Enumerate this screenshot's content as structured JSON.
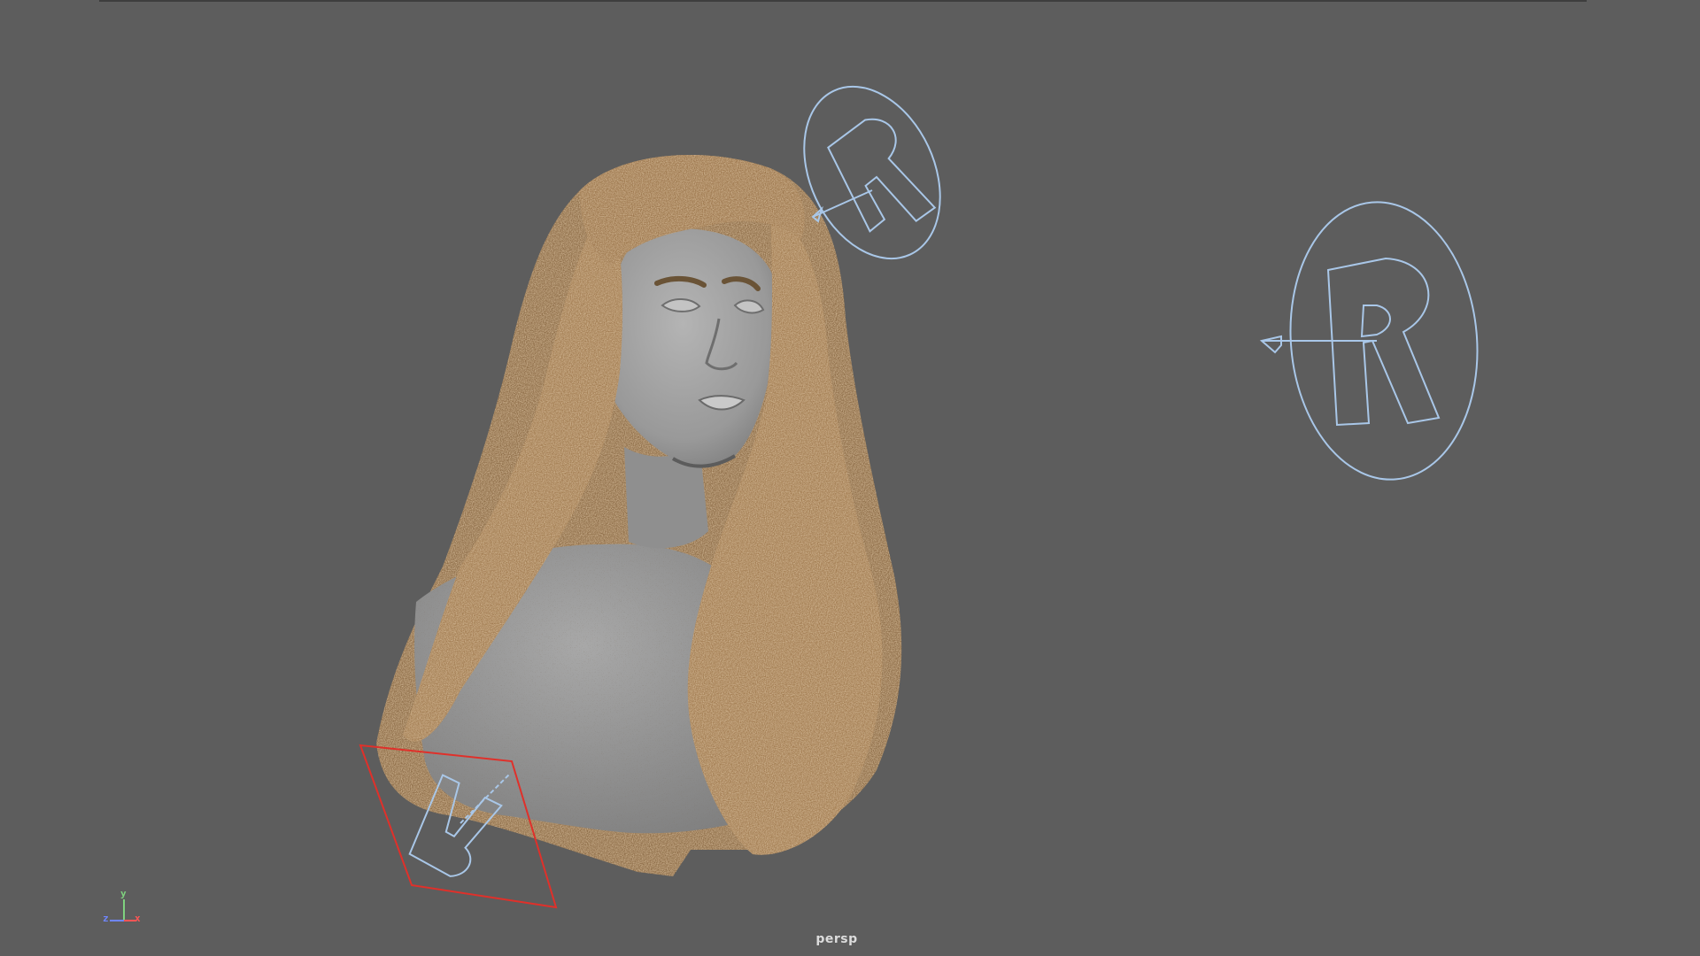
{
  "viewport": {
    "camera_name": "persp",
    "background_color": "#5d5d5d"
  },
  "axis_gizmo": {
    "x_label": "x",
    "y_label": "y",
    "z_label": "z",
    "x_color": "#ff5555",
    "y_color": "#7fd27f",
    "z_color": "#6f86ff"
  },
  "scene": {
    "character": "bust-with-long-hair",
    "hair_color": "#b78c5c",
    "mesh_color": "#9c9c9c",
    "light_gizmo_color": "#a9c7e8",
    "selection_color": "#e0302a",
    "lights": [
      {
        "name": "area-light",
        "selected": false
      },
      {
        "name": "area-light",
        "selected": false
      },
      {
        "name": "area-light",
        "selected": true
      }
    ]
  }
}
